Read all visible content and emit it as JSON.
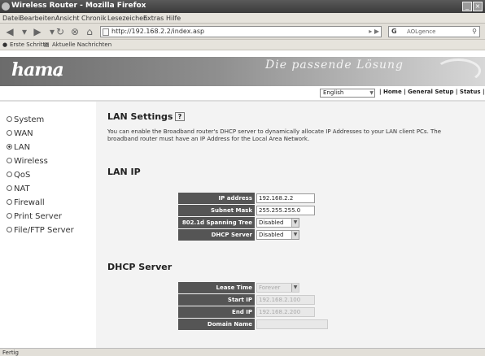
{
  "window": {
    "title": "Wireless Router - Mozilla Firefox"
  },
  "menubar": {
    "items": [
      "Datei",
      "Bearbeiten",
      "Ansicht",
      "Chronik",
      "Lesezeichen",
      "Extras",
      "Hilfe"
    ]
  },
  "navbar": {
    "url": "http://192.168.2.2/index.asp",
    "search_engine": "G",
    "search_placeholder": "AOLgence"
  },
  "bookmarks": {
    "items": [
      "Erste Schritte",
      "Aktuelle Nachrichten"
    ]
  },
  "header": {
    "logo": "hama",
    "slogan": "Die passende Lösung",
    "language": "English",
    "topnav": "| Home | General Setup | Status | To"
  },
  "sidebar": {
    "items": [
      {
        "label": "System",
        "selected": false
      },
      {
        "label": "WAN",
        "selected": false
      },
      {
        "label": "LAN",
        "selected": true
      },
      {
        "label": "Wireless",
        "selected": false
      },
      {
        "label": "QoS",
        "selected": false
      },
      {
        "label": "NAT",
        "selected": false
      },
      {
        "label": "Firewall",
        "selected": false
      },
      {
        "label": "Print Server",
        "selected": false
      },
      {
        "label": "File/FTP Server",
        "selected": false
      }
    ]
  },
  "main": {
    "title": "LAN Settings",
    "help": "?",
    "description": "You can enable the Broadband router's DHCP server to dynamically allocate IP Addresses to your LAN client PCs. The broadband router must have an IP Address for the Local Area Network.",
    "lanip": {
      "heading": "LAN IP",
      "ip_label": "IP address",
      "ip_value": "192.168.2.2",
      "mask_label": "Subnet Mask",
      "mask_value": "255.255.255.0",
      "stp_label": "802.1d Spanning Tree",
      "stp_value": "Disabled",
      "dhcp_label": "DHCP Server",
      "dhcp_value": "Disabled"
    },
    "dhcp": {
      "heading": "DHCP Server",
      "lease_label": "Lease Time",
      "lease_value": "Forever",
      "start_label": "Start IP",
      "start_value": "192.168.2.100",
      "end_label": "End IP",
      "end_value": "192.168.2.200",
      "domain_label": "Domain Name",
      "domain_value": ""
    }
  },
  "status": {
    "text": "Fertig"
  }
}
